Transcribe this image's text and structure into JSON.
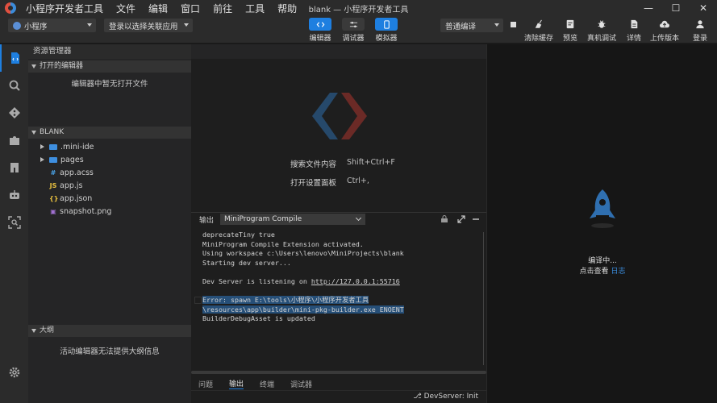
{
  "window": {
    "title": "blank — 小程序开发者工具",
    "menu": [
      "小程序开发者工具",
      "文件",
      "编辑",
      "窗口",
      "前往",
      "工具",
      "帮助"
    ],
    "controls": [
      "minimize-icon",
      "maximize-icon",
      "close-icon"
    ]
  },
  "toolbar": {
    "project_select": "小程序",
    "app_select": "登录以选择关联应用",
    "mode_buttons": [
      {
        "label": "编辑器",
        "icon": "code-icon",
        "active": true
      },
      {
        "label": "调试器",
        "icon": "sliders-icon",
        "active": false
      },
      {
        "label": "模拟器",
        "icon": "phone-icon",
        "active": true
      }
    ],
    "compile_select": "普通编译",
    "actions": [
      {
        "label": "清除缓存",
        "icon": "broom-icon"
      },
      {
        "label": "预览",
        "icon": "preview-icon"
      },
      {
        "label": "真机调试",
        "icon": "bug-icon"
      },
      {
        "label": "详情",
        "icon": "document-icon"
      },
      {
        "label": "上传版本",
        "icon": "cloud-upload-icon"
      },
      {
        "label": "登录",
        "icon": "user-icon"
      }
    ]
  },
  "explorer": {
    "title": "资源管理器",
    "open_editors": {
      "header": "打开的编辑器",
      "empty": "编辑器中暂无打开文件"
    },
    "project": {
      "header": "BLANK",
      "items": [
        {
          "name": ".mini-ide",
          "type": "folder"
        },
        {
          "name": "pages",
          "type": "folder"
        },
        {
          "name": "app.acss",
          "type": "file",
          "badge": "#",
          "color": "#4aa3e8"
        },
        {
          "name": "app.js",
          "type": "file",
          "badge": "JS",
          "color": "#e8c040"
        },
        {
          "name": "app.json",
          "type": "file",
          "badge": "{}",
          "color": "#e8c040"
        },
        {
          "name": "snapshot.png",
          "type": "file",
          "badge": "▣",
          "color": "#a070d0"
        }
      ]
    },
    "outline": {
      "header": "大纲",
      "empty": "活动编辑器无法提供大纲信息"
    }
  },
  "editor": {
    "hints": [
      {
        "label": "搜索文件内容",
        "key": "Shift+Ctrl+F"
      },
      {
        "label": "打开设置面板",
        "key": "Ctrl+,"
      }
    ]
  },
  "panel": {
    "label": "输出",
    "channel": "MiniProgram Compile",
    "lines": [
      "deprecateTiny true",
      "MiniProgram Compile Extension activated.",
      "Using workspace c:\\Users\\lenovo\\MiniProjects\\blank",
      "Starting dev server...",
      "",
      "Dev Server is listening on ",
      "",
      "Error: spawn E:\\tools\\小程序\\小程序开发者工具",
      "\\resources\\app\\builder\\mini-pkg-builder.exe ENOENT",
      "BuilderDebugAsset is updated"
    ],
    "url": "http://127.0.0.1:55716",
    "tabs": [
      "问题",
      "输出",
      "终端",
      "调试器"
    ],
    "active_tab": "输出"
  },
  "status": {
    "text": "DevServer: Init"
  },
  "simulator": {
    "compiling": "编译中...",
    "view_prompt": "点击查看",
    "log_link": "日志"
  }
}
